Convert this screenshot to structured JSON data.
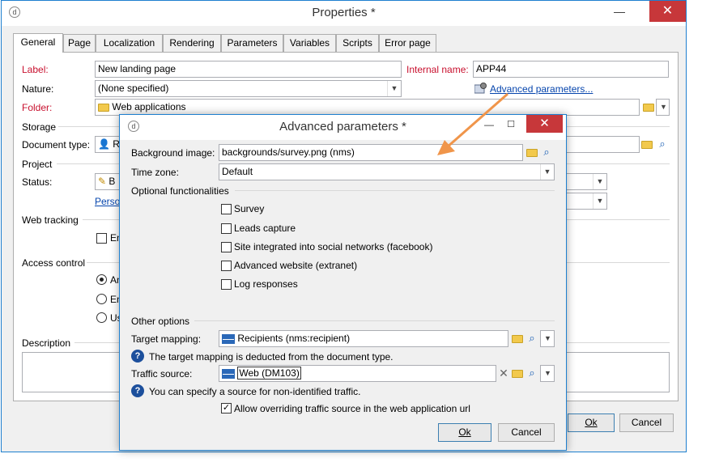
{
  "main_window": {
    "title": "Properties *",
    "tabs": [
      "General",
      "Page",
      "Localization",
      "Rendering",
      "Parameters",
      "Variables",
      "Scripts",
      "Error page"
    ],
    "general": {
      "label_label": "Label:",
      "label_value": "New landing page",
      "internal_name_label": "Internal name:",
      "internal_name_value": "APP44",
      "nature_label": "Nature:",
      "nature_value": "(None specified)",
      "advanced_link": "Advanced parameters...",
      "folder_label": "Folder:",
      "folder_value": "Web applications",
      "storage_label": "Storage",
      "document_type_label": "Document type:",
      "document_type_value": "R",
      "project_label": "Project",
      "status_label": "Status:",
      "status_value": "B",
      "personalize_link": "Perso",
      "web_tracking_label": "Web tracking",
      "web_tracking_checkbox": "En",
      "access_control_label": "Access control",
      "access_options": [
        "An",
        "En",
        "Us"
      ],
      "description_label": "Description"
    },
    "buttons": {
      "ok": "Ok",
      "cancel": "Cancel"
    }
  },
  "dialog": {
    "title": "Advanced parameters *",
    "background_image_label": "Background image:",
    "background_image_value": "backgrounds/survey.png (nms)",
    "time_zone_label": "Time zone:",
    "time_zone_value": "Default",
    "optional_label": "Optional functionalities",
    "options": [
      {
        "label": "Survey",
        "checked": false
      },
      {
        "label": "Leads capture",
        "checked": false
      },
      {
        "label": "Site integrated into social networks (facebook)",
        "checked": false
      },
      {
        "label": "Advanced website (extranet)",
        "checked": false
      },
      {
        "label": "Log responses",
        "checked": false
      }
    ],
    "other_options_label": "Other options",
    "target_mapping_label": "Target mapping:",
    "target_mapping_value": "Recipients (nms:recipient)",
    "target_mapping_help": "The target mapping is deducted from the document type.",
    "traffic_source_label": "Traffic source:",
    "traffic_source_value": "Web (DM103)",
    "traffic_source_help": "You can specify a source for non-identified traffic.",
    "allow_override_label": "Allow overriding traffic source in the web application url",
    "allow_override_checked": true,
    "buttons": {
      "ok": "Ok",
      "cancel": "Cancel"
    }
  },
  "colors": {
    "accent": "#1e7fcf",
    "close_red": "#c7373a",
    "required_red": "#c8102e",
    "arrow": "#f0954a",
    "link": "#0645ad"
  }
}
